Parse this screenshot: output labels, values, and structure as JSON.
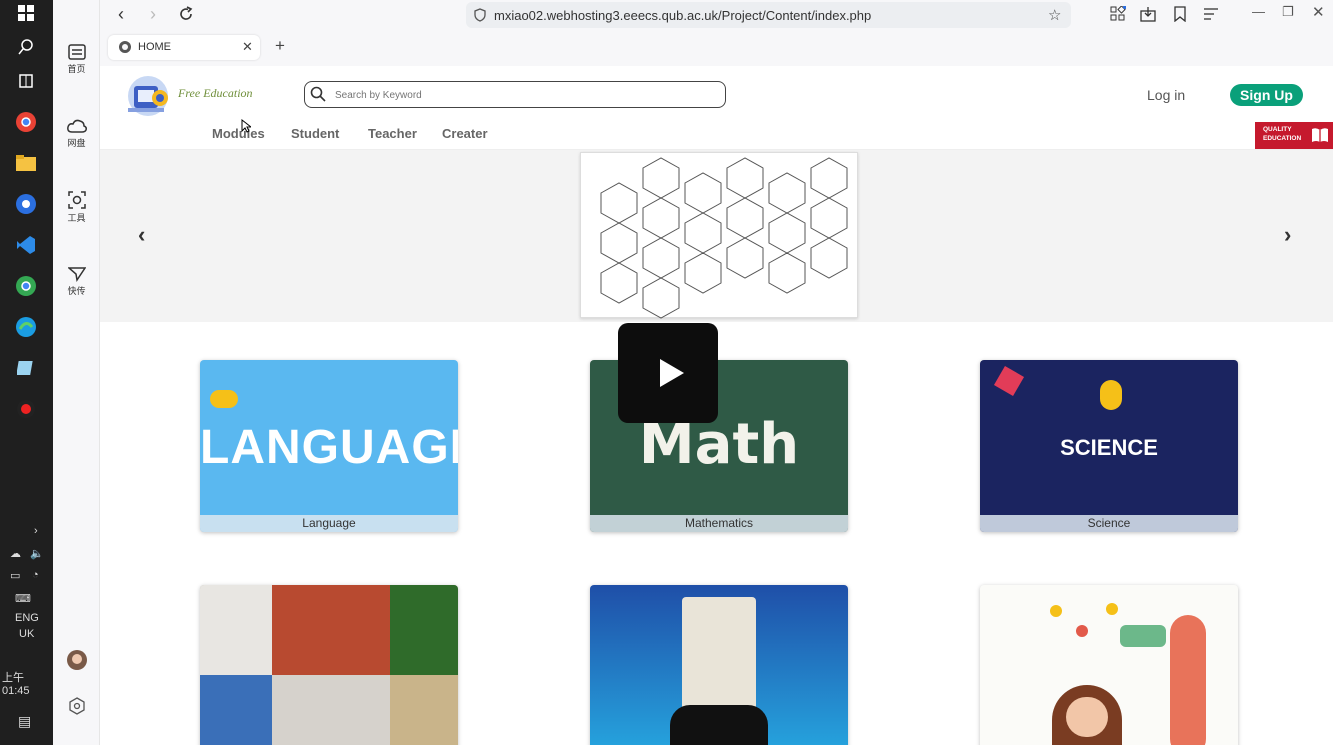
{
  "taskbar": {
    "lang_line1": "ENG",
    "lang_line2": "UK",
    "clock": "上午 01:45"
  },
  "sidepanel": {
    "items": [
      {
        "label": "首页"
      },
      {
        "label": "网盘"
      },
      {
        "label": "工具"
      },
      {
        "label": "快传"
      }
    ]
  },
  "browser": {
    "url": "mxiao02.webhosting3.eeecs.qub.ac.uk/Project/Content/index.php",
    "tab_title": "HOME",
    "new_tab_label": "+"
  },
  "site": {
    "logo_text": "Free Education",
    "search_placeholder": "Search by Keyword",
    "nav": [
      "Modules",
      "Student",
      "Teacher",
      "Creater"
    ],
    "login_label": "Log in",
    "signup_label": "Sign Up",
    "badge_line1": "QUALITY",
    "badge_line2": "EDUCATION"
  },
  "colors": {
    "accent": "#0aa07a",
    "badge": "#c5192d"
  },
  "modules": [
    {
      "caption": "Language",
      "art_text": "LANGUAGE"
    },
    {
      "caption": "Mathematics",
      "art_text": "Math"
    },
    {
      "caption": "Science",
      "art_text": "SCIENCE"
    }
  ]
}
